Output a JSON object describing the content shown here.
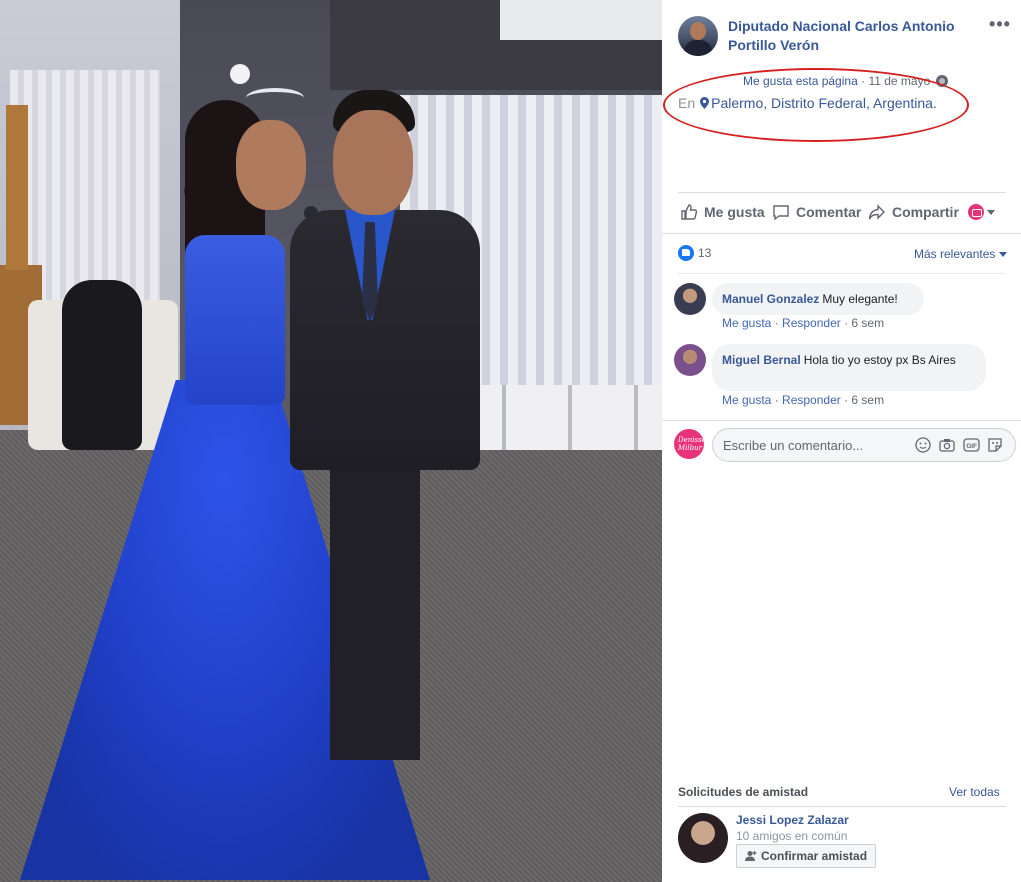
{
  "post": {
    "page_name": "Diputado Nacional Carlos Antonio Portillo Verón",
    "more": "•••",
    "like_page": "Me gusta esta página",
    "dot": "·",
    "date": "11 de mayo",
    "location_prefix": "En",
    "location": "Palermo, Distrito Federal, Argentina."
  },
  "actions": {
    "like": "Me gusta",
    "comment": "Comentar",
    "share": "Compartir"
  },
  "reactions": {
    "count": "13",
    "sort": "Más relevantes"
  },
  "comments": [
    {
      "name": "Manuel Gonzalez",
      "text": "Muy elegante!",
      "like": "Me gusta",
      "reply": "Responder",
      "time": "6 sem"
    },
    {
      "name": "Miguel Bernal",
      "text": "Hola tio yo estoy px Bs Aires",
      "like": "Me gusta",
      "reply": "Responder",
      "time": "6 sem"
    }
  ],
  "composer": {
    "placeholder": "Escribe un comentario...",
    "avatar_text": "Denisse Milbur"
  },
  "friend_requests": {
    "title": "Solicitudes de amistad",
    "see_all": "Ver todas",
    "name": "Jessi Lopez Zalazar",
    "mutual": "10 amigos en común",
    "confirm": "Confirmar amistad"
  },
  "colors": {
    "link": "#385898",
    "highlight": "#d42020",
    "dress": "#2343c8"
  },
  "icons": [
    "ellipsis-icon",
    "globe-icon",
    "location-pin-icon",
    "thumbs-up-icon",
    "comment-icon",
    "share-icon",
    "reaction-selector-icon",
    "like-badge-icon",
    "emoji-icon",
    "camera-icon",
    "gif-icon",
    "sticker-icon",
    "add-friend-icon"
  ]
}
